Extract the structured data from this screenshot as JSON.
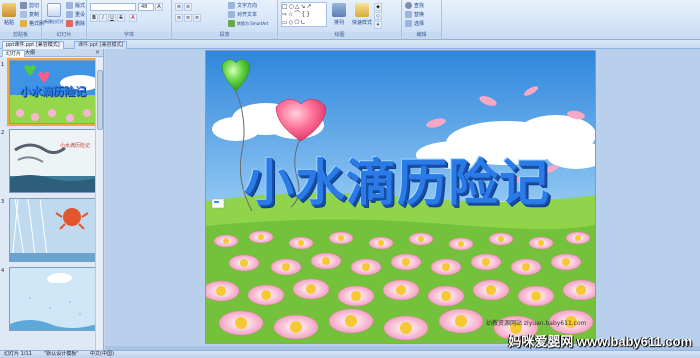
{
  "ribbon": {
    "paste_label": "粘贴",
    "cut_label": "剪切",
    "copy_label": "复制",
    "format_painter_label": "格式刷",
    "new_slide_label": "新建幻灯片",
    "layout_label": "版式",
    "reset_label": "重设",
    "delete_label": "删除",
    "font_size_value": "48",
    "text_direction_label": "文字方向",
    "align_text_label": "对齐文本",
    "convert_smartart_label": "转换为 SmartArt",
    "arrange_label": "排列",
    "quick_styles_label": "快速样式",
    "find_label": "查找",
    "replace_label": "替换",
    "select_label": "选择",
    "groups": {
      "clipboard": "剪贴板",
      "slides": "幻灯片",
      "font": "字体",
      "paragraph": "段落",
      "drawing": "绘图",
      "editing": "编辑"
    }
  },
  "tabs": {
    "doc1": "ppt课件.ppt [兼容模式]",
    "doc2": "课件.ppt [兼容模式]"
  },
  "left_panel": {
    "tab_slides": "幻灯片",
    "tab_outline": "大纲",
    "close": "×",
    "slide_numbers": [
      "1",
      "2",
      "3",
      "4"
    ]
  },
  "slide": {
    "title": "小水滴历险记",
    "thumb_title": "小水滴历险记",
    "thumb2_caption": "小水滴历险记",
    "website": "幼教资源网站 ziyuan.baby611.com",
    "watermark": "妈咪爱婴网 www.baby611.com"
  },
  "status": {
    "slide_counter": "幻灯片 1/11",
    "theme": "\"默认设计模板\"",
    "language": "中文(中国)"
  },
  "colors": {
    "sky": "#3a8fe0",
    "grass": "#8fd44a",
    "title": "#2a7be8",
    "heart_pink": "#ff5c8a",
    "heart_green": "#54c83a"
  }
}
